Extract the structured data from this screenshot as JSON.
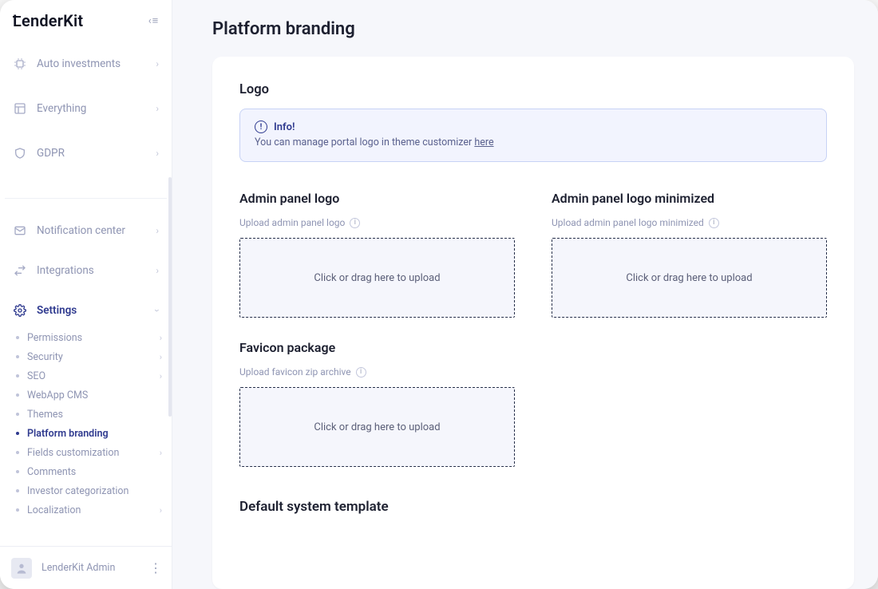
{
  "brand": "LenderKit",
  "page_title": "Platform branding",
  "sidebar": {
    "items": [
      {
        "label": "Auto investments",
        "icon": "cpu",
        "expandable": true
      },
      {
        "label": "Everything",
        "icon": "layout",
        "expandable": true
      },
      {
        "label": "GDPR",
        "icon": "shield",
        "expandable": true
      }
    ],
    "items2": [
      {
        "label": "Notification center",
        "icon": "mail",
        "expandable": true
      },
      {
        "label": "Integrations",
        "icon": "swap",
        "expandable": true
      },
      {
        "label": "Settings",
        "icon": "gear",
        "expandable": true,
        "active": true
      }
    ],
    "sub": [
      {
        "label": "Permissions",
        "chev": true
      },
      {
        "label": "Security",
        "chev": true
      },
      {
        "label": "SEO",
        "chev": true
      },
      {
        "label": "WebApp CMS",
        "chev": false
      },
      {
        "label": "Themes",
        "chev": false
      },
      {
        "label": "Platform branding",
        "chev": false,
        "active": true
      },
      {
        "label": "Fields customization",
        "chev": true
      },
      {
        "label": "Comments",
        "chev": false
      },
      {
        "label": "Investor categorization",
        "chev": false
      },
      {
        "label": "Localization",
        "chev": true
      }
    ]
  },
  "user": {
    "name": "LenderKit Admin"
  },
  "logo_section": {
    "title": "Logo",
    "info_title": "Info!",
    "info_text": "You can manage portal logo in theme customizer ",
    "info_link": "here"
  },
  "uploads": {
    "admin_logo": {
      "title": "Admin panel logo",
      "subtitle": "Upload admin panel logo",
      "dropzone": "Click or drag here to upload"
    },
    "admin_logo_min": {
      "title": "Admin panel logo minimized",
      "subtitle": "Upload admin panel logo minimized",
      "dropzone": "Click or drag here to upload"
    },
    "favicon": {
      "title": "Favicon package",
      "subtitle": "Upload favicon zip archive",
      "dropzone": "Click or drag here to upload"
    }
  },
  "bottom_section": "Default system template"
}
